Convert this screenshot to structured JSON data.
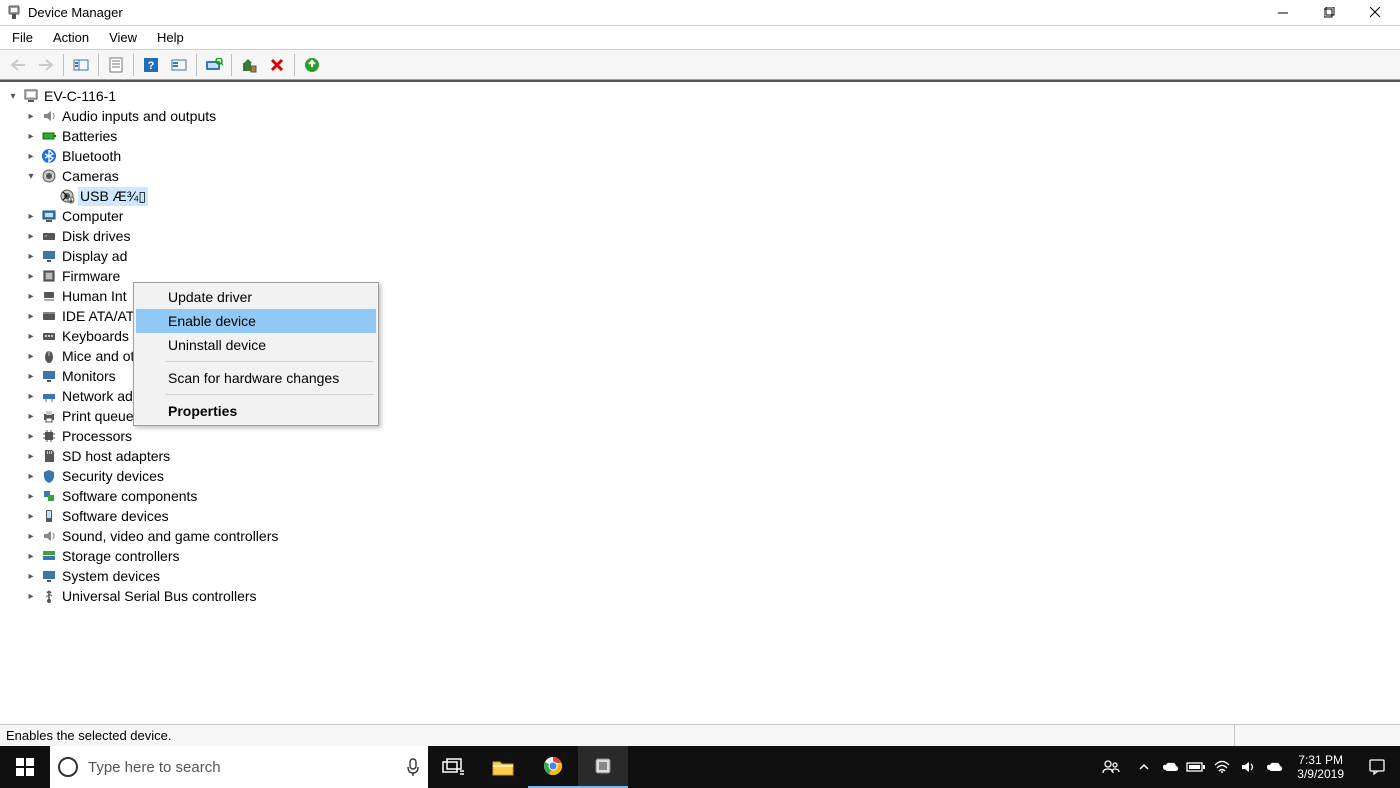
{
  "window": {
    "title": "Device Manager"
  },
  "menu": {
    "file": "File",
    "action": "Action",
    "view": "View",
    "help": "Help"
  },
  "status": {
    "text": "Enables the selected device."
  },
  "tree": {
    "root": "EV-C-116-1",
    "cat_audio": "Audio inputs and outputs",
    "cat_batteries": "Batteries",
    "cat_bluetooth": "Bluetooth",
    "cat_cameras": "Cameras",
    "camera_device": "USB Æ¾▯",
    "cat_computer": "Computer",
    "cat_disk": "Disk drives",
    "cat_display": "Display ad",
    "cat_firmware": "Firmware",
    "cat_hid": "Human Int",
    "cat_ide": "IDE ATA/AT",
    "cat_keyboards": "Keyboards",
    "cat_mice": "Mice and other pointing devices",
    "cat_monitors": "Monitors",
    "cat_network": "Network adapters",
    "cat_print": "Print queues",
    "cat_processors": "Processors",
    "cat_sd": "SD host adapters",
    "cat_security": "Security devices",
    "cat_swcomp": "Software components",
    "cat_swdev": "Software devices",
    "cat_sound": "Sound, video and game controllers",
    "cat_storage": "Storage controllers",
    "cat_system": "System devices",
    "cat_usb": "Universal Serial Bus controllers"
  },
  "context_menu": {
    "update": "Update driver",
    "enable": "Enable device",
    "uninstall": "Uninstall device",
    "scan": "Scan for hardware changes",
    "properties": "Properties"
  },
  "taskbar": {
    "search_placeholder": "Type here to search",
    "time": "7:31 PM",
    "date": "3/9/2019"
  }
}
